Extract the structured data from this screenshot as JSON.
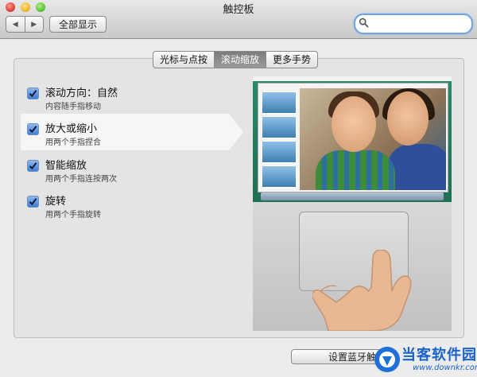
{
  "window": {
    "title": "触控板"
  },
  "toolbar": {
    "back_glyph": "◀",
    "forward_glyph": "▶",
    "show_all_label": "全部显示",
    "search_placeholder": "",
    "search_value": ""
  },
  "tabs": [
    {
      "label": "光标与点按",
      "active": false
    },
    {
      "label": "滚动缩放",
      "active": true
    },
    {
      "label": "更多手势",
      "active": false
    }
  ],
  "options": [
    {
      "title": "滚动方向：自然",
      "subtitle": "内容随手指移动",
      "checked": true
    },
    {
      "title": "放大或缩小",
      "subtitle": "用两个手指捏合",
      "checked": true,
      "selected": true
    },
    {
      "title": "智能缩放",
      "subtitle": "用两个手指连按两次",
      "checked": true
    },
    {
      "title": "旋转",
      "subtitle": "用两个手指旋转",
      "checked": true
    }
  ],
  "bottom": {
    "bluetooth_button_label": "设置蓝牙触"
  },
  "watermark": {
    "brand": "当客软件园",
    "url": "www.downkr.com"
  },
  "colors": {
    "accent": "#3e7fd6",
    "watermark": "#1a63c8",
    "active_tab": "#8a8a8a"
  },
  "icons": [
    "back-arrow-icon",
    "forward-arrow-icon",
    "search-icon",
    "checkmark-icon",
    "hand-icon"
  ]
}
